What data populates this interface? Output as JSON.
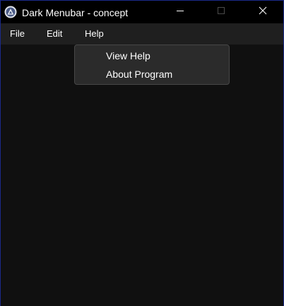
{
  "window": {
    "title": "Dark Menubar - concept",
    "icon": "app-logo-icon",
    "controls": {
      "minimize_icon": "minimize-icon",
      "maximize_icon": "maximize-icon",
      "close_icon": "close-icon"
    },
    "accent_border": "#1b2a8a"
  },
  "menubar": {
    "items": [
      {
        "label": "File"
      },
      {
        "label": "Edit"
      },
      {
        "label": "Help"
      }
    ]
  },
  "help_menu": {
    "items": [
      {
        "label": "View Help"
      },
      {
        "label": "About Program"
      }
    ]
  },
  "colors": {
    "titlebar": "#000000",
    "menubar": "#1f1f1f",
    "content": "#101010",
    "dropdown": "#2b2b2b"
  }
}
